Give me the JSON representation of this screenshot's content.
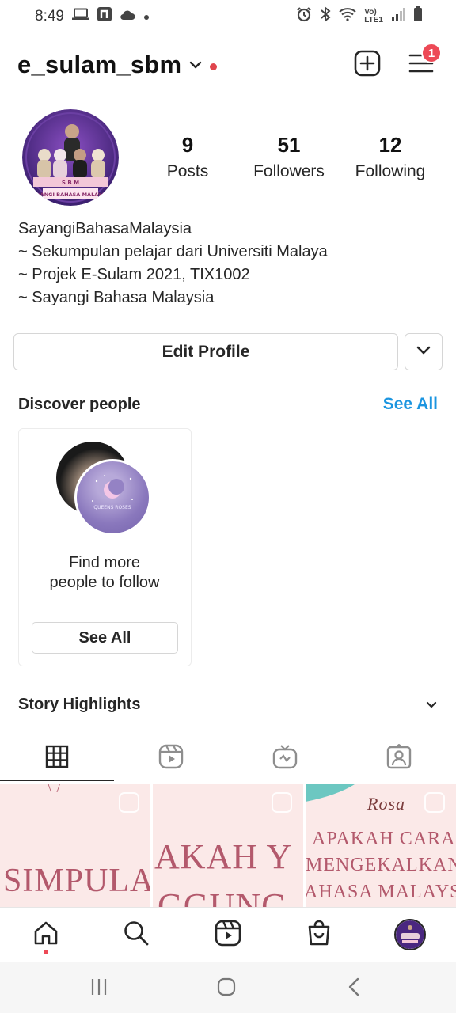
{
  "status_bar": {
    "time": "8:49",
    "left_icons": [
      "laptop-icon",
      "n-app-icon",
      "cloud-icon",
      "dot-icon"
    ],
    "right_icons": [
      "alarm-icon",
      "bluetooth-icon",
      "wifi-icon",
      "volte-icon",
      "signal-icon",
      "battery-icon"
    ],
    "volte_line1": "Vo)",
    "volte_line2": "LTE1"
  },
  "header": {
    "username": "e_sulam_sbm",
    "notification_count": "1"
  },
  "profile": {
    "stats": [
      {
        "value": "9",
        "label": "Posts"
      },
      {
        "value": "51",
        "label": "Followers"
      },
      {
        "value": "12",
        "label": "Following"
      }
    ],
    "bio_name": "SayangiBahasaMalaysia",
    "bio_lines": [
      "~ Sekumpulan pelajar dari Universiti Malaya",
      "~ Projek E-Sulam 2021, TIX1002",
      "~ Sayangi Bahasa Malaysia"
    ],
    "avatar_caption": "SAYANGI BAHASA MALAYSIA",
    "avatar_caption_top": "S B M"
  },
  "actions": {
    "edit_profile_label": "Edit Profile"
  },
  "discover": {
    "title": "Discover people",
    "see_all_link": "See All",
    "card_text_line1": "Find more",
    "card_text_line2": "people to follow",
    "card_button": "See All",
    "card_avatar_caption": "QUEENS ROSES"
  },
  "highlights": {
    "title": "Story Highlights"
  },
  "tabs": [
    "grid-icon",
    "reels-icon",
    "igtv-icon",
    "tagged-icon"
  ],
  "grid_posts": [
    {
      "text_top": "\\ /",
      "text_main": "SIMPULA"
    },
    {
      "text_main": "AKAH Y",
      "text_sub": "GGUNG"
    },
    {
      "text_script": "Rosa",
      "text_line1": "APAKAH CARA",
      "text_line2": "MENGEKALKAN",
      "text_line3": "AHASA MALAYSI"
    }
  ],
  "colors": {
    "accent_blue": "#1b95e0",
    "badge_red": "#ed4956",
    "post_pink": "#fbe9e8",
    "post_text": "#b3596c",
    "avatar_purple": "#3a1f6e"
  }
}
